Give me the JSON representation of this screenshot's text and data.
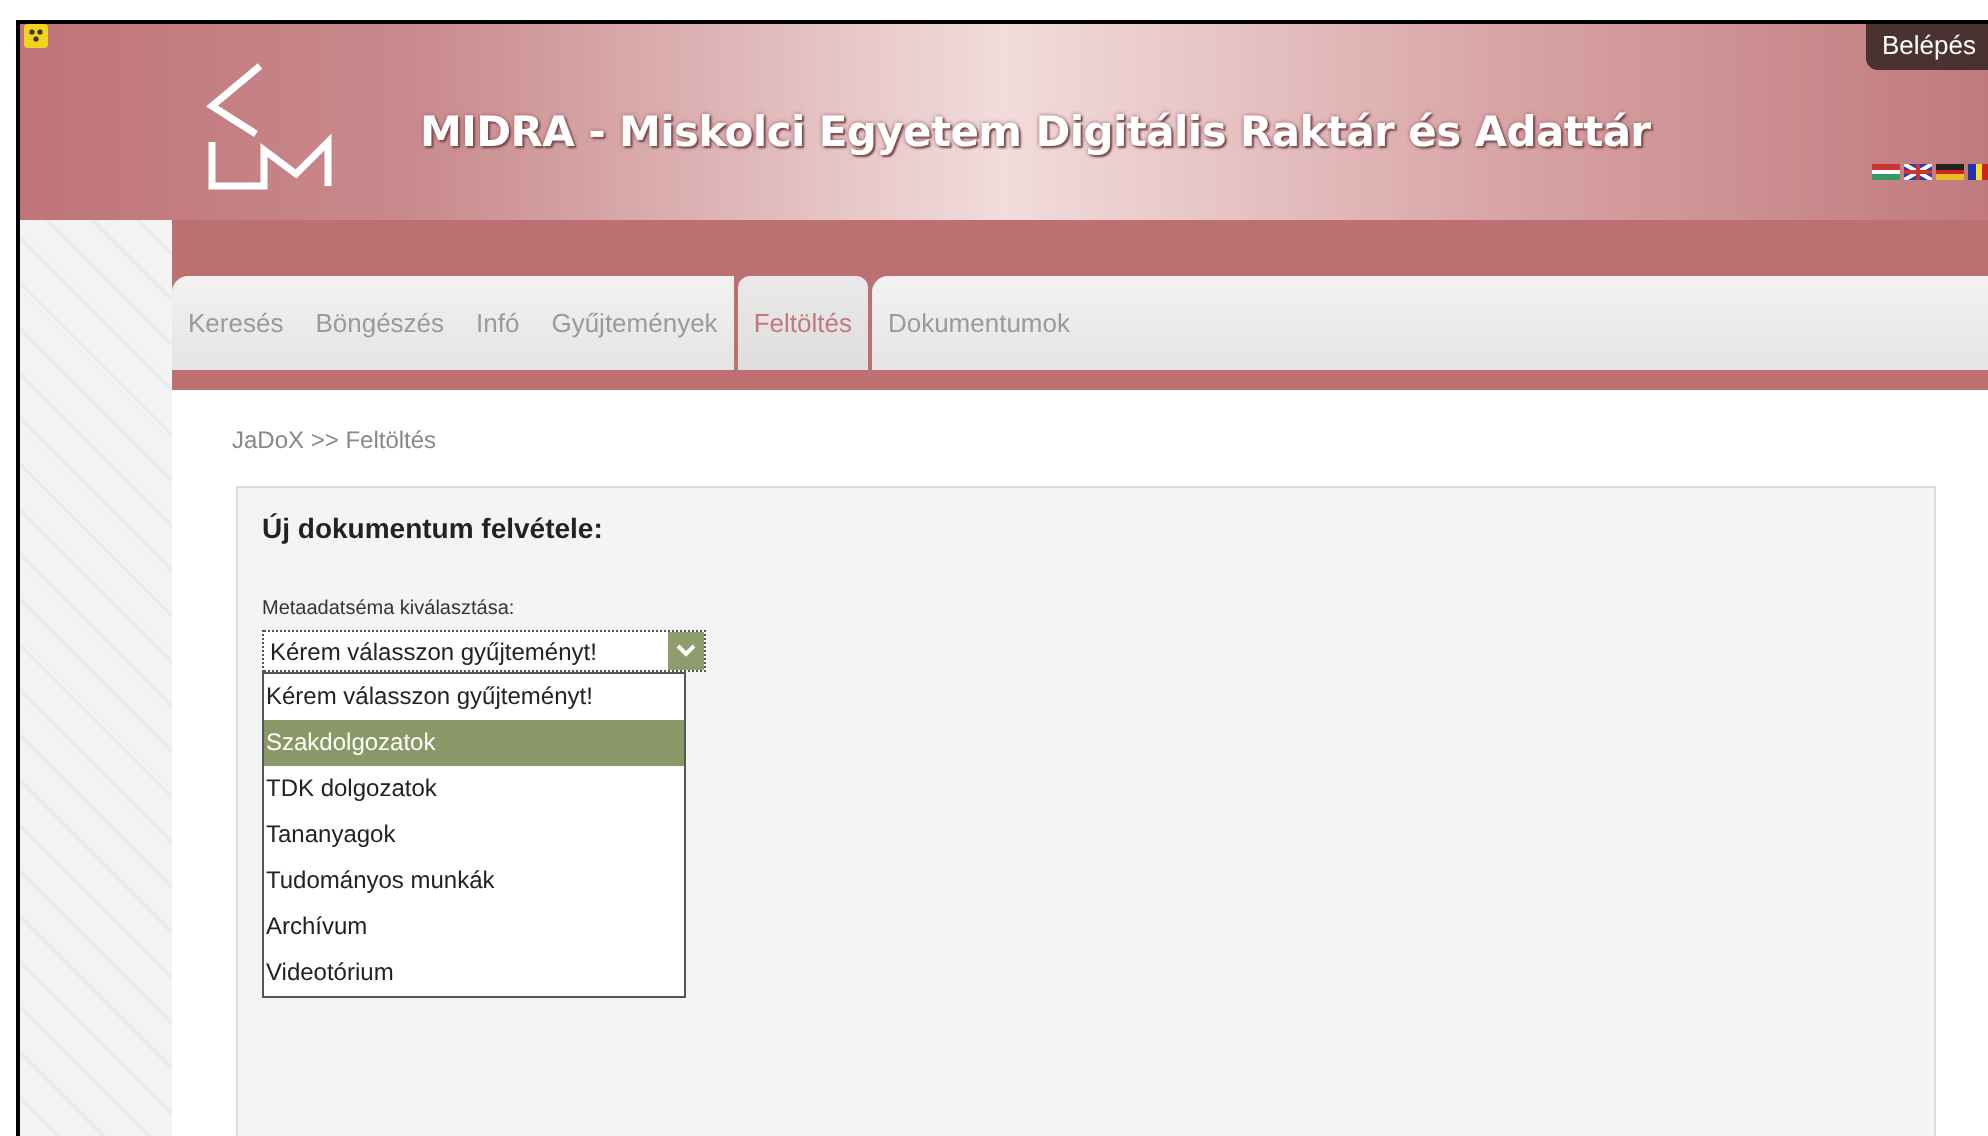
{
  "header": {
    "title": "MIDRA - Miskolci Egyetem Digitális Raktár és Adattár",
    "login": "Belépés"
  },
  "tabs": [
    {
      "label": "Keresés",
      "selected": false
    },
    {
      "label": "Böngészés",
      "selected": false
    },
    {
      "label": "Infó",
      "selected": false
    },
    {
      "label": "Gyűjtemények",
      "selected": false
    },
    {
      "label": "Feltöltés",
      "selected": true
    },
    {
      "label": "Dokumentumok",
      "selected": false
    }
  ],
  "breadcrumb": "JaDoX >> Feltöltés",
  "form": {
    "heading": "Új dokumentum felvétele:",
    "field_label": "Metaadatséma kiválasztása:",
    "select": {
      "value": "Kérem válasszon gyűjteményt!",
      "expanded": true,
      "options": [
        {
          "label": "Kérem válasszon gyűjteményt!",
          "highlighted": false
        },
        {
          "label": "Szakdolgozatok",
          "highlighted": true
        },
        {
          "label": "TDK dolgozatok",
          "highlighted": false
        },
        {
          "label": "Tananyagok",
          "highlighted": false
        },
        {
          "label": "Tudományos munkák",
          "highlighted": false
        },
        {
          "label": "Archívum",
          "highlighted": false
        },
        {
          "label": "Videotórium",
          "highlighted": false
        }
      ]
    }
  }
}
